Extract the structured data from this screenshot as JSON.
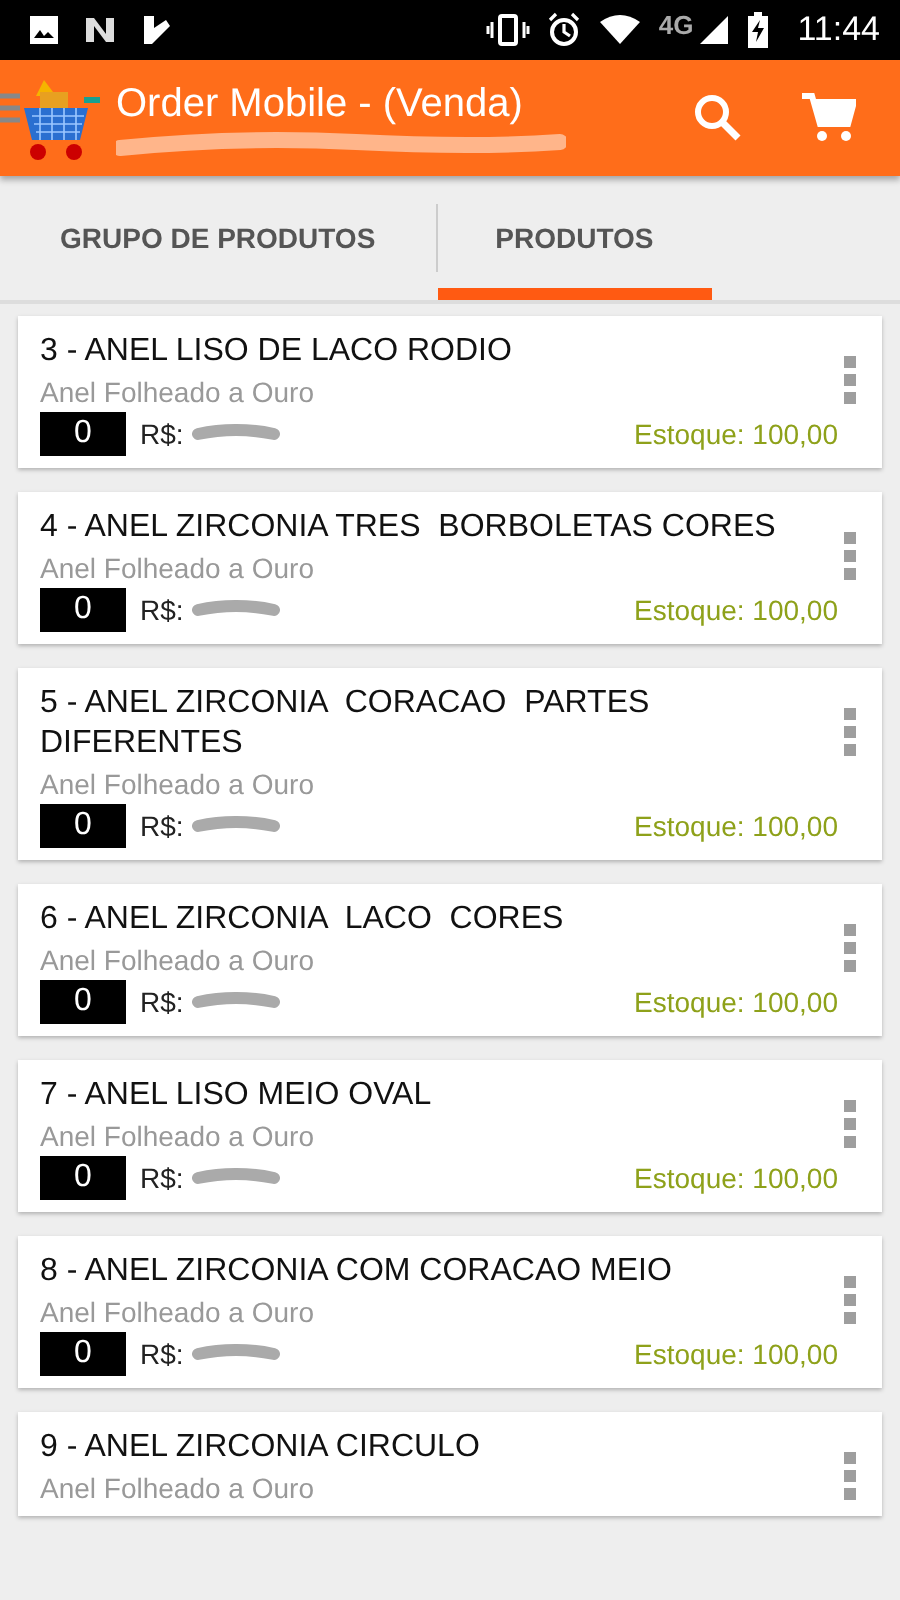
{
  "status_bar": {
    "network": "4G",
    "time": "11:44"
  },
  "app_bar": {
    "title": "Order Mobile - (Venda)"
  },
  "tabs": [
    {
      "label": "GRUPO DE PRODUTOS",
      "selected": false
    },
    {
      "label": "PRODUTOS",
      "selected": true
    }
  ],
  "products": [
    {
      "title": "3 - ANEL LISO DE LACO RODIO",
      "subtitle": "Anel Folheado a Ouro",
      "quantity": "0",
      "price_label": "R$:",
      "stock": "Estoque: 100,00"
    },
    {
      "title": "4 - ANEL ZIRCONIA TRES  BORBOLETAS CORES",
      "subtitle": "Anel Folheado a Ouro",
      "quantity": "0",
      "price_label": "R$:",
      "stock": "Estoque: 100,00"
    },
    {
      "title": "5 - ANEL ZIRCONIA  CORACAO  PARTES DIFERENTES",
      "subtitle": "Anel Folheado a Ouro",
      "quantity": "0",
      "price_label": "R$:",
      "stock": "Estoque: 100,00"
    },
    {
      "title": "6 - ANEL ZIRCONIA  LACO  CORES",
      "subtitle": "Anel Folheado a Ouro",
      "quantity": "0",
      "price_label": "R$:",
      "stock": "Estoque: 100,00"
    },
    {
      "title": "7 - ANEL LISO MEIO OVAL",
      "subtitle": "Anel Folheado a Ouro",
      "quantity": "0",
      "price_label": "R$:",
      "stock": "Estoque: 100,00"
    },
    {
      "title": "8 - ANEL ZIRCONIA COM CORACAO MEIO",
      "subtitle": "Anel Folheado a Ouro",
      "quantity": "0",
      "price_label": "R$:",
      "stock": "Estoque: 100,00"
    },
    {
      "title": "9 - ANEL ZIRCONIA CIRCULO",
      "subtitle": "Anel Folheado a Ouro"
    }
  ]
}
